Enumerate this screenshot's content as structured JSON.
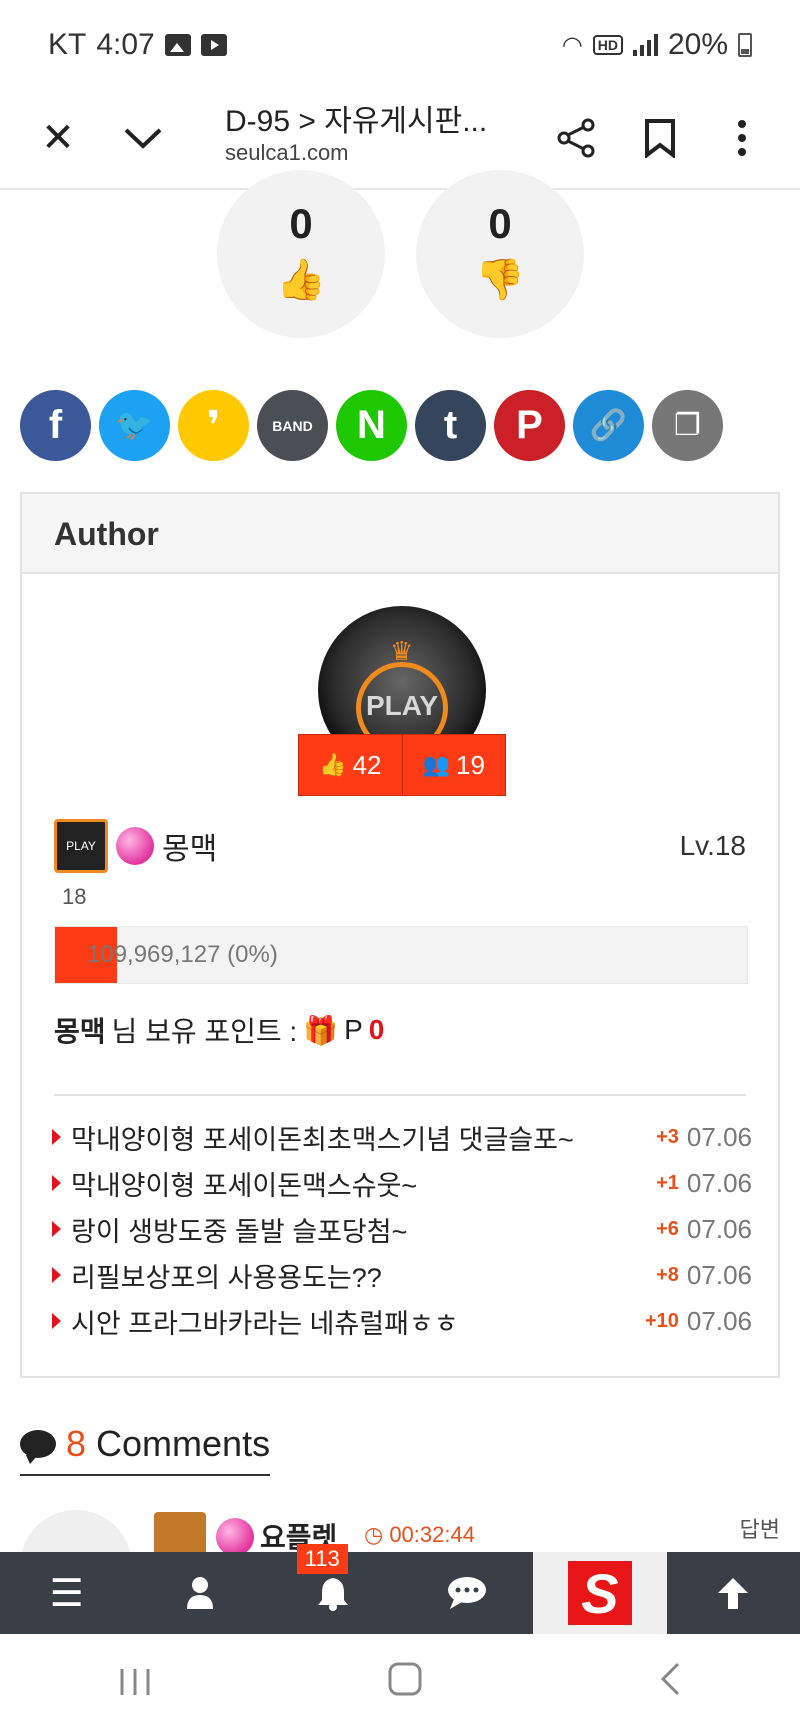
{
  "status_bar": {
    "carrier": "KT",
    "time": "4:07",
    "battery": "20%",
    "hd_label": "HD"
  },
  "browser": {
    "title": "D-95 > 자유게시판...",
    "url": "seulca1.com"
  },
  "votes": {
    "up_count": "0",
    "down_count": "0"
  },
  "share_buttons": [
    {
      "name": "facebook",
      "glyph": "f",
      "color": "#3b5998"
    },
    {
      "name": "twitter",
      "glyph": "🐦",
      "color": "#1da1f2"
    },
    {
      "name": "kakaostory",
      "glyph": "❜",
      "color": "#ffc800"
    },
    {
      "name": "band",
      "glyph": "BAND",
      "color": "#4a4f56"
    },
    {
      "name": "naver",
      "glyph": "N",
      "color": "#1ec800"
    },
    {
      "name": "tumblr",
      "glyph": "t",
      "color": "#35465c"
    },
    {
      "name": "pinterest",
      "glyph": "P",
      "color": "#cb2027"
    },
    {
      "name": "copy-link",
      "glyph": "🔗",
      "color": "#1f8ad6"
    },
    {
      "name": "copy",
      "glyph": "❐",
      "color": "#777777"
    }
  ],
  "author": {
    "heading": "Author",
    "avatar_text": "PLAY",
    "likes": "42",
    "followers": "19",
    "nickname": "몽맥",
    "level": "Lv.18",
    "level_num": "18",
    "lvl_icon_text": "PLAY",
    "xp_text": "109,969,127 (0%)",
    "xp_fraction": 0.09,
    "points_name": "몽맥",
    "points_label": "님 보유 포인트 :",
    "points_prefix": "P",
    "points_value": "0"
  },
  "recent_posts": [
    {
      "title": "막내양이형 포세이돈최초맥스기념 댓글슬포~",
      "comments": "+3",
      "date": "07.06"
    },
    {
      "title": "막내양이형 포세이돈맥스슈웃~",
      "comments": "+1",
      "date": "07.06"
    },
    {
      "title": "랑이 생방도중 돌발 슬포당첨~",
      "comments": "+6",
      "date": "07.06"
    },
    {
      "title": "리필보상포의 사용용도는??",
      "comments": "+8",
      "date": "07.06"
    },
    {
      "title": "시안 프라그바카라는 네츄럴패ㅎㅎ",
      "comments": "+10",
      "date": "07.06"
    }
  ],
  "comments": {
    "count": "8",
    "label": "Comments",
    "first": {
      "nickname": "요플렛",
      "time": "00:32:44",
      "reply_label": "답변"
    }
  },
  "bottom_nav": {
    "notif_badge": "113",
    "logo_letter": "S"
  },
  "colors": {
    "accent": "#ff3b16",
    "nav_bg": "#3a3f47"
  }
}
